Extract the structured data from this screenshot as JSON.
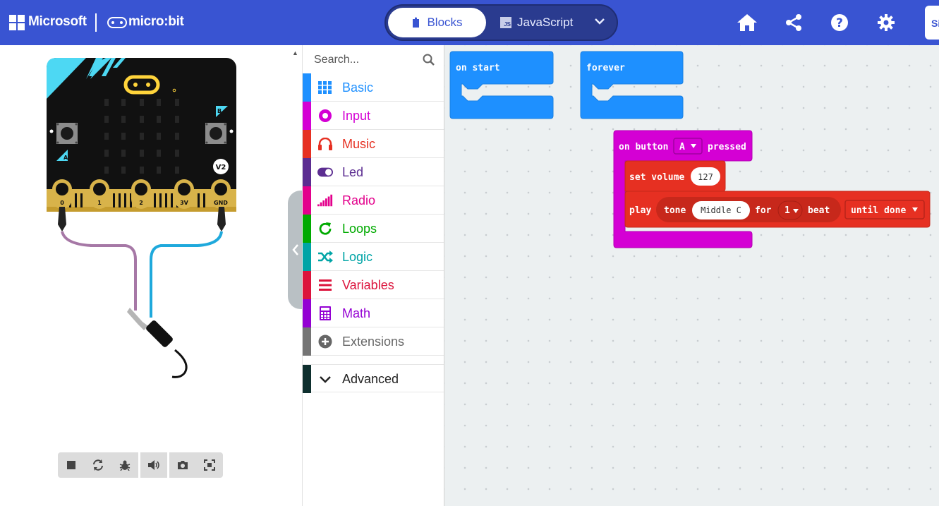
{
  "header": {
    "brand_microsoft": "Microsoft",
    "brand_microbit": "micro:bit",
    "tabs": {
      "blocks": "Blocks",
      "javascript": "JavaScript",
      "js_badge": "JS"
    },
    "signin_label": "Si",
    "colors": {
      "header_bg": "#3954d2"
    },
    "icons": [
      "home-icon",
      "share-icon",
      "help-icon",
      "settings-icon"
    ]
  },
  "simulator": {
    "pin_labels": [
      "0",
      "1",
      "2",
      "3V",
      "GND"
    ],
    "button_a": "A",
    "button_b": "B",
    "version_badge": "V2",
    "toolbar_icons": [
      "stop-icon",
      "restart-icon",
      "debug-icon",
      "mute-icon",
      "screenshot-icon",
      "fullscreen-icon"
    ]
  },
  "toolbox": {
    "search_placeholder": "Search...",
    "categories": [
      {
        "label": "Basic",
        "color": "#1e90ff"
      },
      {
        "label": "Input",
        "color": "#d400d4"
      },
      {
        "label": "Music",
        "color": "#e63022"
      },
      {
        "label": "Led",
        "color": "#5c2d91"
      },
      {
        "label": "Radio",
        "color": "#e3008c"
      },
      {
        "label": "Loops",
        "color": "#00aa00"
      },
      {
        "label": "Logic",
        "color": "#00a4a6"
      },
      {
        "label": "Variables",
        "color": "#dc143c"
      },
      {
        "label": "Math",
        "color": "#9400d3"
      },
      {
        "label": "Extensions",
        "color": "#757575"
      }
    ],
    "advanced_label": "Advanced"
  },
  "workspace": {
    "on_start_label": "on start",
    "forever_label": "forever",
    "event": {
      "prefix": "on button",
      "button": "A",
      "suffix": "pressed"
    },
    "set_volume": {
      "label": "set volume",
      "value": "127"
    },
    "play": {
      "label": "play",
      "tone_label": "tone",
      "note": "Middle C",
      "for_label": "for",
      "beats": "1",
      "beat_label": "beat",
      "mode": "until done"
    },
    "colors": {
      "basic": "#1e90ff",
      "input": "#d400d4",
      "music": "#e63022",
      "music_dark": "#c7281b"
    }
  }
}
